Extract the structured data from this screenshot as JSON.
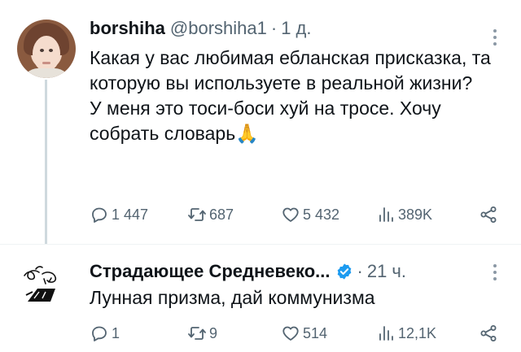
{
  "tweets": [
    {
      "author": {
        "name": "borshiha",
        "handle": "@borshiha1",
        "time": "1 д."
      },
      "text": {
        "line1": "Какая у вас любимая ебланская присказка, та которую вы используете в реальной жизни?",
        "line2": "У меня это тоси-боси хуй на тросе. Хочу собрать словарь🙏"
      },
      "stats": {
        "replies": "1 447",
        "retweets": "687",
        "likes": "5 432",
        "views": "389K"
      }
    },
    {
      "author": {
        "name": "Страдающее Средневеко...",
        "verified": true,
        "time": "21 ч."
      },
      "text": {
        "line1": "Лунная призма, дай коммунизма"
      },
      "stats": {
        "replies": "1",
        "retweets": "9",
        "likes": "514",
        "views": "12,1K"
      }
    }
  ],
  "colors": {
    "text": "#0f1419",
    "secondary": "#536471",
    "verified": "#1d9bf0",
    "divider": "#eff3f4"
  }
}
